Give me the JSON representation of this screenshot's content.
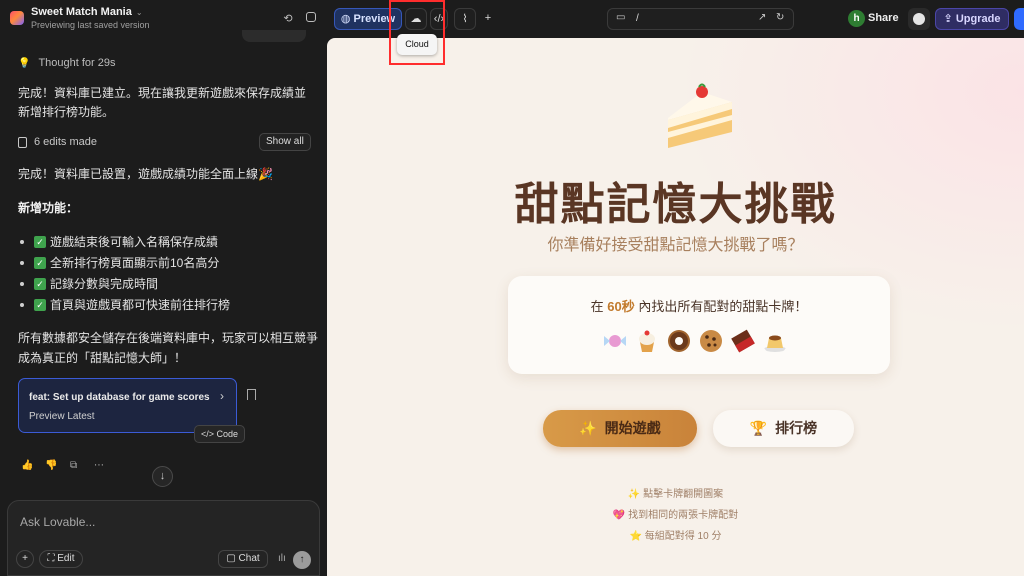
{
  "project": {
    "name": "Sweet Match Mania",
    "subtitle": "Previewing last saved version"
  },
  "chat": {
    "thought": "Thought for 29s",
    "msg1": "完成！資料庫已建立。現在讓我更新遊戲來保存成績並新增排行榜功能。",
    "edits": "6 edits made",
    "show_all": "Show all",
    "msg2": "完成！資料庫已設置，遊戲成績功能全面上線🎉",
    "features_heading": "新增功能：",
    "features": [
      "遊戲結束後可輸入名稱保存成績",
      "全新排行榜頁面顯示前10名高分",
      "記錄分數與完成時間",
      "首頁與遊戲頁都可快速前往排行榜"
    ],
    "msg3": "所有數據都安全儲存在後端資料庫中，玩家可以相互競爭成為真正的「甜點記憶大師」！",
    "commit_title": "feat: Set up database for game scores",
    "commit_sub": "Preview Latest",
    "code_btn": "Code",
    "composer_placeholder": "Ask Lovable...",
    "edit_btn": "Edit",
    "chat_btn": "Chat"
  },
  "toolbar": {
    "preview": "Preview",
    "tooltip": "Cloud",
    "url": "/",
    "share": "Share",
    "upgrade": "Upgrade",
    "avatar_letter": "h"
  },
  "game": {
    "title": "甜點記憶大挑戰",
    "subtitle": "你準備好接受甜點記憶大挑戰了嗎？",
    "rule_pre": "在",
    "rule_time": "60秒",
    "rule_post": "內找出所有配對的甜點卡牌！",
    "start": "開始遊戲",
    "leaderboard": "排行榜",
    "tips": [
      "✨ 點擊卡牌翻開圖案",
      "💖 找到相同的兩張卡牌配對",
      "⭐ 每組配對得 10 分"
    ],
    "sweet_icons": [
      "candy",
      "cupcake",
      "donut",
      "cookie",
      "chocolate",
      "pudding"
    ]
  },
  "colors": {
    "accent_blue": "#3657b8",
    "highlight_red": "#ff2d2d",
    "title_brown": "#5a3624",
    "start_orange": "#d89a48"
  }
}
